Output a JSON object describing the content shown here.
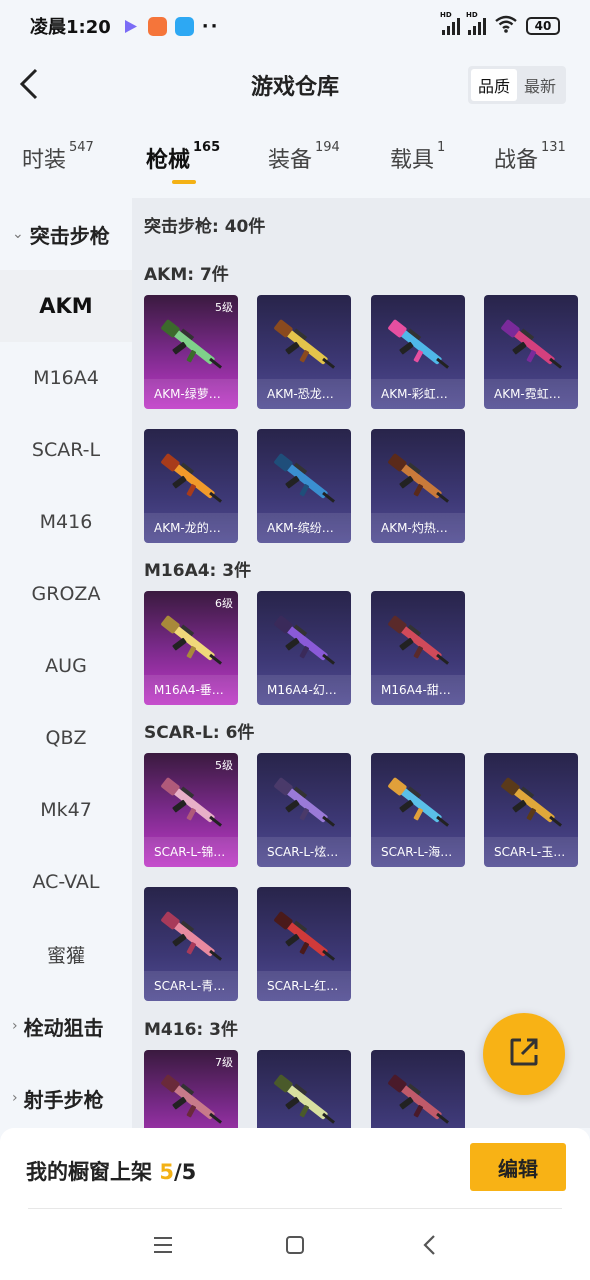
{
  "status_bar": {
    "time": "凌晨1:20",
    "signal1": "HD",
    "signal2": "HD",
    "battery": "40",
    "app_icons": [
      "video-play-icon",
      "orange-app-icon",
      "blue-app-icon"
    ],
    "more": "··"
  },
  "header": {
    "title": "游戏仓库",
    "sort": [
      "品质",
      "最新"
    ],
    "active_sort": "品质"
  },
  "tabs": [
    {
      "label": "时装",
      "count": "547"
    },
    {
      "label": "枪械",
      "count": "165"
    },
    {
      "label": "装备",
      "count": "194"
    },
    {
      "label": "载具",
      "count": "1"
    },
    {
      "label": "战备",
      "count": "131"
    }
  ],
  "active_tab": "枪械",
  "sidebar": {
    "groups": [
      "突击步枪",
      "栓动狙击",
      "射手步枪"
    ],
    "items": [
      "AKM",
      "M16A4",
      "SCAR-L",
      "M416",
      "GROZA",
      "AUG",
      "QBZ",
      "Mk47",
      "AC-VAL",
      "蜜獾"
    ],
    "active_item": "AKM"
  },
  "content": {
    "category_title": "突击步枪: 40件",
    "sections": [
      {
        "title": "AKM: 7件",
        "cards": [
          {
            "name": "AKM-绿萝…",
            "level": "5级",
            "tier": "gold"
          },
          {
            "name": "AKM-恐龙…",
            "tier": "blue"
          },
          {
            "name": "AKM-彩虹…",
            "tier": "blue"
          },
          {
            "name": "AKM-霓虹…",
            "tier": "blue"
          },
          {
            "name": "AKM-龙的…",
            "tier": "blue"
          },
          {
            "name": "AKM-缤纷…",
            "tier": "blue"
          },
          {
            "name": "AKM-灼热…",
            "tier": "blue"
          }
        ]
      },
      {
        "title": "M16A4: 3件",
        "cards": [
          {
            "name": "M16A4-垂…",
            "level": "6级",
            "tier": "gold"
          },
          {
            "name": "M16A4-幻…",
            "tier": "blue"
          },
          {
            "name": "M16A4-甜…",
            "tier": "blue"
          }
        ]
      },
      {
        "title": "SCAR-L: 6件",
        "cards": [
          {
            "name": "SCAR-L-锦…",
            "level": "5级",
            "tier": "gold"
          },
          {
            "name": "SCAR-L-炫…",
            "tier": "blue"
          },
          {
            "name": "SCAR-L-海…",
            "tier": "blue"
          },
          {
            "name": "SCAR-L-玉…",
            "tier": "blue"
          },
          {
            "name": "SCAR-L-青…",
            "tier": "blue"
          },
          {
            "name": "SCAR-L-红…",
            "tier": "blue"
          }
        ]
      },
      {
        "title": "M416: 3件",
        "cards": [
          {
            "name": "",
            "level": "7级",
            "tier": "gold"
          },
          {
            "name": "",
            "tier": "blue"
          },
          {
            "name": "",
            "tier": "blue"
          }
        ]
      }
    ]
  },
  "fab": {
    "icon": "share-icon"
  },
  "bottom": {
    "label": "我的橱窗上架",
    "current": "5",
    "sep_total": "/5",
    "edit": "编辑"
  },
  "navbar": {
    "icons": [
      "menu-icon",
      "home-icon",
      "back-icon"
    ]
  },
  "colors": {
    "accent": "#f8b215",
    "gold_card": "#b53bbf",
    "blue_card": "#3d3875"
  }
}
